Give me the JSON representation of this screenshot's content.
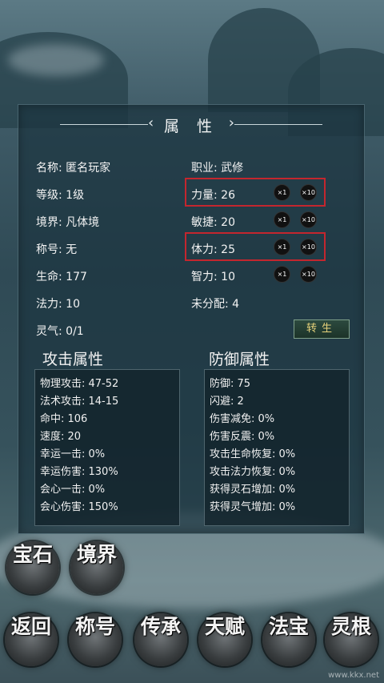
{
  "panel": {
    "title": "属 性",
    "left_arrow": "‹",
    "right_arrow": "›"
  },
  "attributes": {
    "name": "名称:  匿名玩家",
    "level": "等级:  1级",
    "realm": "境界:  凡体境",
    "nickname": "称号:  无",
    "hp": "生命:  177",
    "mana": "法力:  10",
    "spirit": "灵气:  0/1",
    "profession": "职业:  武修",
    "strength": "力量:  26",
    "agility": "敏捷:  20",
    "stamina": "体力:  25",
    "intellect": "智力:  10",
    "unallocated": "未分配:  4"
  },
  "multipliers": {
    "x1": "×1",
    "x10": "×10"
  },
  "rebirth_label": "转生",
  "attack": {
    "title": "攻击属性",
    "stats": [
      "物理攻击:  47-52",
      "法术攻击:  14-15",
      "命中:  106",
      "速度:  20",
      "幸运一击:  0%",
      "幸运伤害:  130%",
      "会心一击:  0%",
      "会心伤害:  150%"
    ]
  },
  "defense": {
    "title": "防御属性",
    "stats": [
      "防御:  75",
      "闪避:  2",
      "伤害减免:  0%",
      "伤害反震:  0%",
      "攻击生命恢复:  0%",
      "攻击法力恢复:  0%",
      "获得灵石增加:  0%",
      "获得灵气增加:  0%"
    ]
  },
  "nav_buttons": {
    "gem": "宝石",
    "realm": "境界",
    "back": "返回",
    "title": "称号",
    "inherit": "传承",
    "talent": "天赋",
    "treasure": "法宝",
    "root": "灵根"
  },
  "watermark": "www.kkx.net",
  "colors": {
    "highlight": "#c4262e",
    "panel_bg": "#1c3440",
    "rebirth_text": "#e6d27a"
  }
}
